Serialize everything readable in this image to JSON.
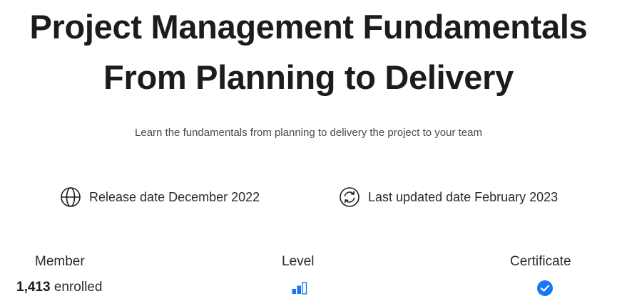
{
  "header": {
    "title_line1": "Project Management Fundamentals",
    "title_line2": "From Planning to Delivery",
    "subtitle": "Learn the fundamentals from planning to delivery the project to your team"
  },
  "meta": {
    "release": {
      "icon": "globe-icon",
      "text": "Release date December 2022"
    },
    "updated": {
      "icon": "refresh-icon",
      "text": "Last updated date February 2023"
    }
  },
  "stats": {
    "member": {
      "label": "Member",
      "count": "1,413",
      "suffix": "enrolled"
    },
    "level": {
      "label": "Level",
      "icon": "level-bars-icon",
      "bars_filled": 2,
      "bars_total": 3
    },
    "certificate": {
      "label": "Certificate",
      "icon": "check-circle-icon"
    }
  },
  "colors": {
    "text_primary": "#1c1c1e",
    "text_secondary": "#4a4a4f",
    "accent": "#1877f2"
  }
}
